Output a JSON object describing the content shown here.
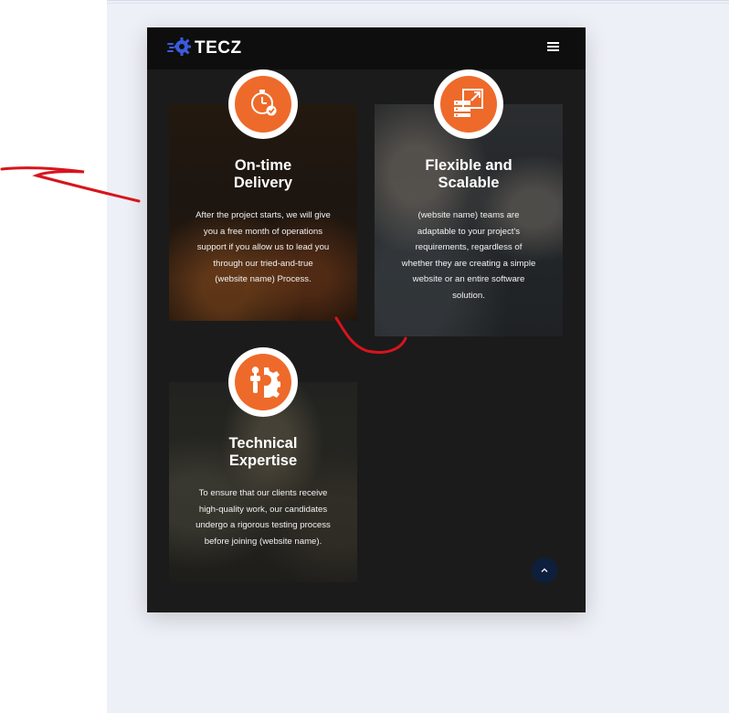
{
  "header": {
    "logo_text": "TECZ",
    "logo_icon": "gear-speed-icon",
    "menu_icon": "hamburger-menu-icon"
  },
  "cards": [
    {
      "title_line1": "On-time",
      "title_line2": "Delivery",
      "description_lines": [
        "After the project starts, we will give",
        "you a free month of operations",
        "support if you allow us to lead you",
        "through our tried-and-true",
        "(website name) Process."
      ],
      "icon": "stopwatch-check-icon"
    },
    {
      "title_line1": "Flexible and",
      "title_line2": "Scalable",
      "description_lines": [
        "(website name) teams are",
        "adaptable to your project's",
        "requirements, regardless of",
        "whether they are creating a simple",
        "website or an entire software",
        "solution."
      ],
      "icon": "server-scale-icon"
    },
    {
      "title_line1": "Technical",
      "title_line2": "Expertise",
      "description_lines": [
        "To ensure that our clients receive",
        "high-quality work, our candidates",
        "undergo a rigorous testing process",
        "before joining (website name)."
      ],
      "icon": "gear-tools-icon"
    }
  ],
  "scroll_top_icon": "chevron-up-icon",
  "colors": {
    "accent_orange": "#ee6a2a",
    "logo_blue": "#3b5bdb",
    "dark_bg": "#1b1b1b",
    "annotation_red": "#d8141c"
  }
}
